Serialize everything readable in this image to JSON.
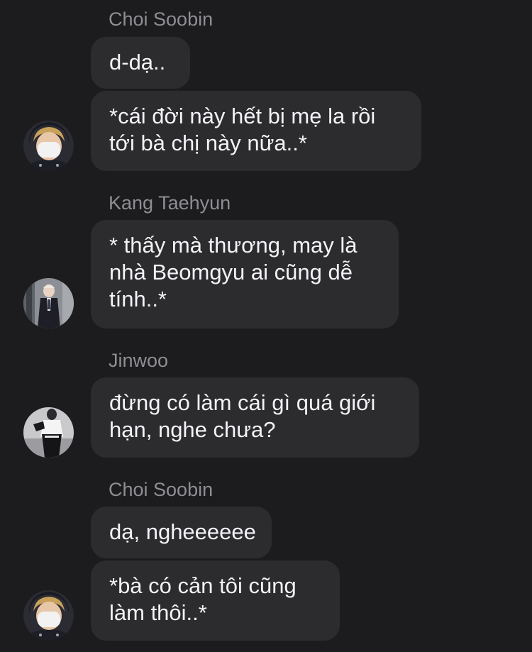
{
  "messages": [
    {
      "sender": "Choi Soobin",
      "bubbles": [
        {
          "lines": [
            "d-dạ.."
          ]
        },
        {
          "lines": [
            "*cái đời này hết bị mẹ la rồi",
            "tới bà chị này nữa..*"
          ]
        }
      ],
      "avatar": "soobin-avatar"
    },
    {
      "sender": "Kang Taehyun",
      "bubbles": [
        {
          "lines": [
            "* thấy mà thương, may là",
            "nhà Beomgyu ai cũng dễ",
            "tính..*"
          ]
        }
      ],
      "avatar": "taehyun-avatar"
    },
    {
      "sender": "Jinwoo",
      "bubbles": [
        {
          "lines": [
            "đừng có làm cái gì quá giới",
            "hạn, nghe chưa?"
          ]
        }
      ],
      "avatar": "jinwoo-avatar"
    },
    {
      "sender": "Choi Soobin",
      "bubbles": [
        {
          "lines": [
            "dạ, ngheeeeee"
          ]
        },
        {
          "lines": [
            "*bà có cản tôi cũng",
            "làm thôi..*"
          ]
        }
      ],
      "avatar": "soobin-avatar"
    }
  ],
  "colors": {
    "background": "#1c1c1e",
    "bubble": "#2c2c2e",
    "sender_name": "#8e8e93",
    "message_text": "#f2f2f7"
  }
}
